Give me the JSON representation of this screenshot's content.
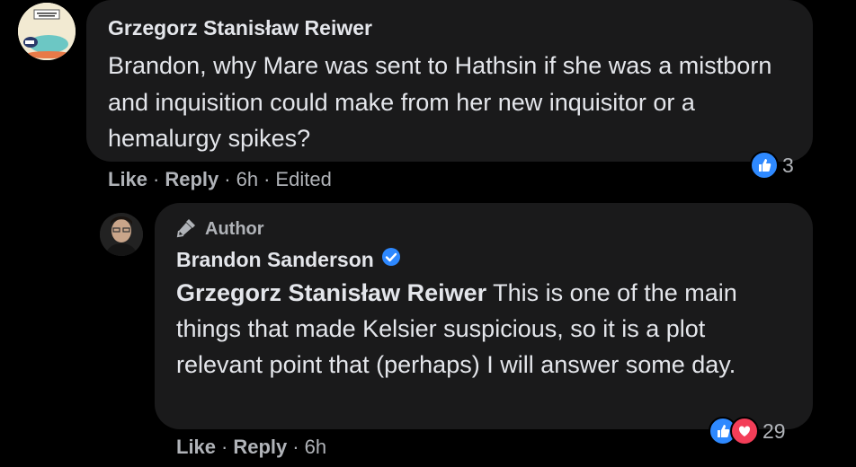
{
  "comment1": {
    "author": "Grzegorz Stanisław Reiwer",
    "text": "Brandon, why Mare was sent to Hathsin if she was a mistborn and inquisition could make from her new inquisitor or a hemalurgy spikes?",
    "actions": {
      "like": "Like",
      "reply": "Reply",
      "time": "6h",
      "edited": "Edited"
    },
    "reaction_count": "3",
    "reactions": [
      "like-icon"
    ]
  },
  "comment2": {
    "badge": "Author",
    "author": "Brandon Sanderson",
    "verified": true,
    "mention": "Grzegorz Stanisław Reiwer",
    "text": "This is one of the main things that made Kelsier suspicious, so it is a plot relevant point that (perhaps) I will answer some day.",
    "actions": {
      "like": "Like",
      "reply": "Reply",
      "time": "6h"
    },
    "reaction_count": "29",
    "reactions": [
      "like-icon",
      "heart-icon"
    ]
  },
  "colors": {
    "background": "#000000",
    "bubble": "#1a1a1b",
    "text": "#e4e6eb",
    "secondary": "#b0b3b8",
    "like": "#2e89ff",
    "love": "#f33e58",
    "verified": "#2d88ff"
  }
}
